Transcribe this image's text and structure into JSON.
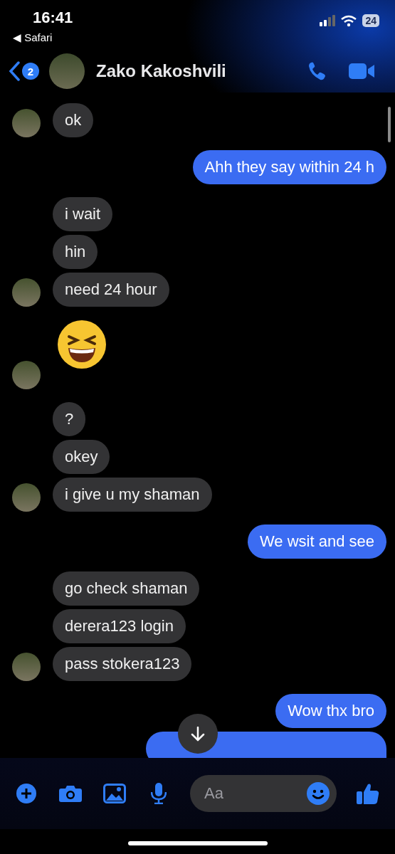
{
  "status_bar": {
    "time": "16:41",
    "back_app": "◀ Safari",
    "battery": "24"
  },
  "header": {
    "back_badge": "2",
    "contact_name": "Zako Kakoshvili"
  },
  "groups": [
    {
      "kind": "incoming",
      "messages": [
        {
          "kind": "text",
          "text": "ok"
        }
      ]
    },
    {
      "kind": "outgoing",
      "messages": [
        {
          "kind": "text",
          "text": "Ahh they say within 24 h"
        }
      ]
    },
    {
      "kind": "incoming",
      "messages": [
        {
          "kind": "text",
          "text": "i wait"
        },
        {
          "kind": "text",
          "text": "hin"
        },
        {
          "kind": "text",
          "text": "need 24 hour"
        }
      ]
    },
    {
      "kind": "incoming",
      "messages": [
        {
          "kind": "emoji"
        }
      ]
    },
    {
      "kind": "incoming",
      "messages": [
        {
          "kind": "text",
          "text": "?"
        },
        {
          "kind": "text",
          "text": "okey"
        },
        {
          "kind": "text",
          "text": "i give u my shaman"
        }
      ]
    },
    {
      "kind": "outgoing",
      "messages": [
        {
          "kind": "text",
          "text": "We wsit and see"
        }
      ]
    },
    {
      "kind": "incoming",
      "messages": [
        {
          "kind": "text",
          "text": "go check shaman"
        },
        {
          "kind": "text",
          "text": "derera123 login"
        },
        {
          "kind": "text",
          "text": "pass stokera123"
        }
      ]
    },
    {
      "kind": "outgoing",
      "messages": [
        {
          "kind": "text",
          "text": "Wow thx bro"
        },
        {
          "kind": "cut-off"
        }
      ]
    }
  ],
  "composer": {
    "placeholder": "Aa"
  }
}
